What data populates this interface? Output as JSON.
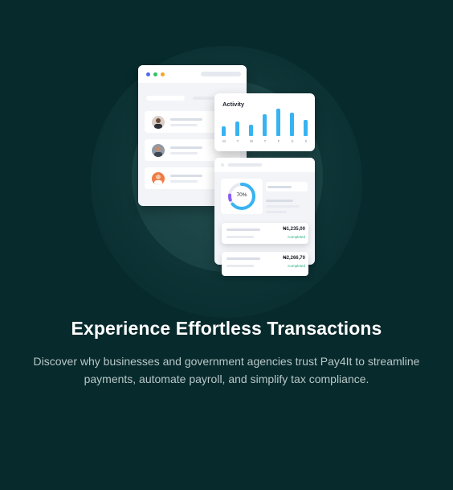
{
  "illustration": {
    "window_dots": [
      {
        "name": "blue-dot",
        "color": "#4f6bea"
      },
      {
        "name": "green-dot",
        "color": "#2fc26a"
      },
      {
        "name": "orange-dot",
        "color": "#f5a623"
      }
    ],
    "activity": {
      "title": "Activity",
      "days": [
        "M",
        "T",
        "W",
        "T",
        "F",
        "S",
        "S"
      ],
      "bar_color": "#38b3f2"
    },
    "donut": {
      "label": "70%",
      "value": 0.7,
      "colors": {
        "primary": "#38b3f2",
        "secondary": "#8b5cf6",
        "track": "#e6e9ef"
      }
    },
    "transactions": [
      {
        "amount": "₦1,235,00",
        "status": "Completed"
      },
      {
        "amount": "₦2,266,70",
        "status": "Completed"
      }
    ]
  },
  "heading": "Experience Effortless Transactions",
  "description": "Discover why businesses and government agencies trust Pay4It to streamline payments, automate payroll, and simplify tax compliance."
}
